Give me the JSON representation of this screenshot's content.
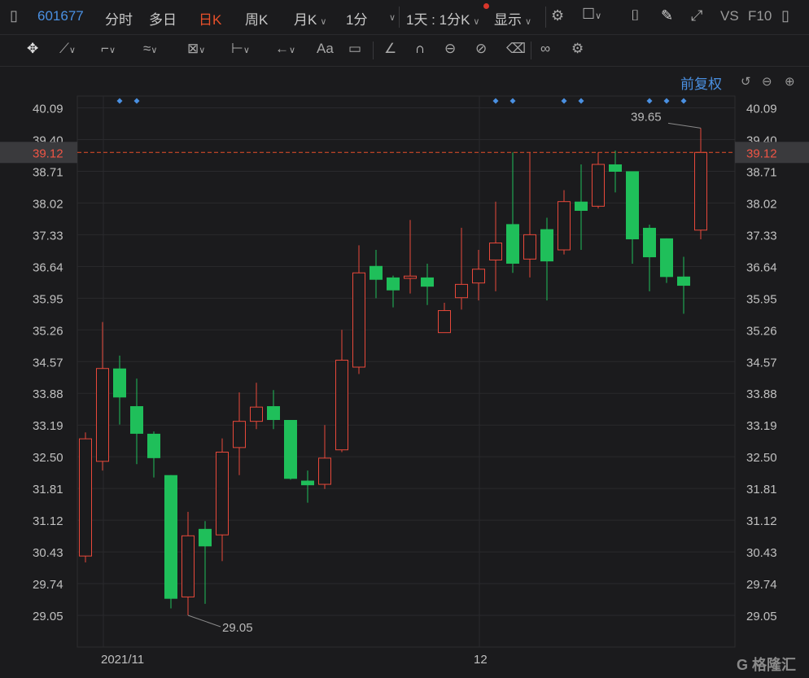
{
  "toolbar": {
    "stock_code": "601677",
    "tabs": [
      "分时",
      "多日",
      "日K",
      "周K",
      "月K"
    ],
    "active_tab": "日K",
    "period": "1分",
    "mode": "1天 : 1分K",
    "display": "显示",
    "vs": "VS",
    "f10": "F10"
  },
  "chart_header": {
    "adjust": "前复权"
  },
  "colors": {
    "up": "#e8483a",
    "down": "#1fbf5a",
    "marker": "#4a90e2",
    "current_line": "#e8502a"
  },
  "chart_data": {
    "type": "candlestick",
    "y_ticks": [
      "40.09",
      "39.40",
      "38.71",
      "38.02",
      "37.33",
      "36.64",
      "35.95",
      "35.26",
      "34.57",
      "33.88",
      "33.19",
      "32.50",
      "31.81",
      "31.12",
      "30.43",
      "29.74",
      "29.05"
    ],
    "ylim": [
      28.8,
      40.28
    ],
    "x_labels": [
      {
        "label": "2021/11",
        "index": 1
      },
      {
        "label": "12",
        "index": 23
      }
    ],
    "current_price": "39.12",
    "annotations": [
      {
        "text": "39.65",
        "index": 36,
        "value": 39.65
      },
      {
        "text": "29.05",
        "index": 6,
        "value": 29.05
      }
    ],
    "markers": [
      2,
      3,
      24,
      25,
      28,
      29,
      33,
      34,
      35
    ],
    "candles": [
      {
        "o": 30.34,
        "c": 32.89,
        "h": 33.03,
        "l": 30.2
      },
      {
        "o": 32.4,
        "c": 34.42,
        "h": 35.43,
        "l": 32.2
      },
      {
        "o": 34.42,
        "c": 33.79,
        "h": 34.7,
        "l": 33.2
      },
      {
        "o": 33.6,
        "c": 33.0,
        "h": 34.2,
        "l": 32.34
      },
      {
        "o": 33.0,
        "c": 32.47,
        "h": 33.05,
        "l": 32.05
      },
      {
        "o": 32.1,
        "c": 29.41,
        "h": 32.1,
        "l": 29.2
      },
      {
        "o": 29.45,
        "c": 30.78,
        "h": 31.3,
        "l": 29.05
      },
      {
        "o": 30.93,
        "c": 30.55,
        "h": 31.1,
        "l": 29.3
      },
      {
        "o": 30.8,
        "c": 32.6,
        "h": 32.9,
        "l": 30.23
      },
      {
        "o": 32.7,
        "c": 33.27,
        "h": 33.9,
        "l": 32.1
      },
      {
        "o": 33.27,
        "c": 33.58,
        "h": 34.11,
        "l": 33.1
      },
      {
        "o": 33.6,
        "c": 33.3,
        "h": 33.95,
        "l": 33.1
      },
      {
        "o": 33.3,
        "c": 32.02,
        "h": 33.3,
        "l": 32.0
      },
      {
        "o": 31.98,
        "c": 31.88,
        "h": 32.2,
        "l": 31.5
      },
      {
        "o": 31.9,
        "c": 32.47,
        "h": 33.19,
        "l": 31.8
      },
      {
        "o": 32.65,
        "c": 34.6,
        "h": 35.26,
        "l": 32.6
      },
      {
        "o": 34.45,
        "c": 36.5,
        "h": 37.1,
        "l": 34.3
      },
      {
        "o": 36.65,
        "c": 36.35,
        "h": 37.0,
        "l": 35.95
      },
      {
        "o": 36.4,
        "c": 36.12,
        "h": 36.44,
        "l": 35.75
      },
      {
        "o": 36.38,
        "c": 36.43,
        "h": 37.65,
        "l": 36.05
      },
      {
        "o": 36.4,
        "c": 36.2,
        "h": 36.7,
        "l": 35.8
      },
      {
        "o": 35.2,
        "c": 35.68,
        "h": 35.85,
        "l": 35.2
      },
      {
        "o": 35.96,
        "c": 36.25,
        "h": 37.48,
        "l": 35.7
      },
      {
        "o": 36.28,
        "c": 36.58,
        "h": 37.0,
        "l": 35.9
      },
      {
        "o": 36.78,
        "c": 37.15,
        "h": 38.05,
        "l": 36.1
      },
      {
        "o": 37.56,
        "c": 36.7,
        "h": 39.12,
        "l": 36.5
      },
      {
        "o": 36.8,
        "c": 37.33,
        "h": 39.12,
        "l": 36.4
      },
      {
        "o": 37.45,
        "c": 36.75,
        "h": 37.7,
        "l": 35.9
      },
      {
        "o": 37.0,
        "c": 38.05,
        "h": 38.3,
        "l": 36.9
      },
      {
        "o": 38.05,
        "c": 37.85,
        "h": 38.86,
        "l": 37.0
      },
      {
        "o": 37.95,
        "c": 38.86,
        "h": 39.12,
        "l": 37.9
      },
      {
        "o": 38.86,
        "c": 38.7,
        "h": 39.16,
        "l": 38.25
      },
      {
        "o": 38.71,
        "c": 37.23,
        "h": 38.71,
        "l": 36.7
      },
      {
        "o": 37.48,
        "c": 36.84,
        "h": 37.55,
        "l": 36.1
      },
      {
        "o": 37.25,
        "c": 36.41,
        "h": 37.25,
        "l": 36.28
      },
      {
        "o": 36.42,
        "c": 36.22,
        "h": 36.85,
        "l": 35.61
      },
      {
        "o": 37.43,
        "c": 39.12,
        "h": 39.65,
        "l": 37.23
      }
    ]
  }
}
